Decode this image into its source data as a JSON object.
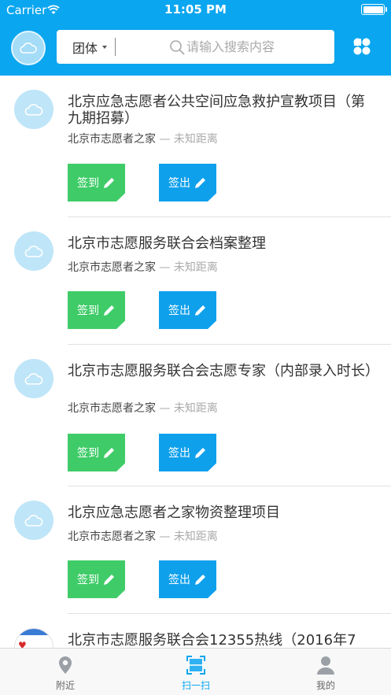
{
  "status_bar": {
    "carrier": "Carrier",
    "time": "11:05 PM"
  },
  "header": {
    "search_type": "团体",
    "search_placeholder": "请输入搜索内容"
  },
  "items": [
    {
      "title": "北京应急志愿者公共空间应急救护宣教项目（第九期招募）",
      "org": "北京市志愿者之家",
      "distance": "— 未知距离",
      "checkin_label": "签到",
      "checkout_label": "签出"
    },
    {
      "title": "北京市志愿服务联合会档案整理",
      "org": "北京市志愿者之家",
      "distance": "— 未知距离",
      "checkin_label": "签到",
      "checkout_label": "签出"
    },
    {
      "title": "北京市志愿服务联合会志愿专家（内部录入时长）",
      "org": "北京市志愿者之家",
      "distance": "— 未知距离",
      "checkin_label": "签到",
      "checkout_label": "签出"
    },
    {
      "title": "北京应急志愿者之家物资整理项目",
      "org": "北京市志愿者之家",
      "distance": "— 未知距离",
      "checkin_label": "签到",
      "checkout_label": "签出"
    },
    {
      "title": "北京市志愿服务联合会12355热线（2016年7"
    }
  ],
  "tabbar": {
    "tabs": [
      {
        "label": "附近",
        "icon": "location-pin-icon"
      },
      {
        "label": "扫一扫",
        "icon": "scan-icon"
      },
      {
        "label": "我的",
        "icon": "person-icon"
      }
    ],
    "active_index": 1
  },
  "colors": {
    "primary": "#0aa6f0",
    "checkin_green": "#3fcc68",
    "checkout_blue": "#0fa0ec"
  }
}
